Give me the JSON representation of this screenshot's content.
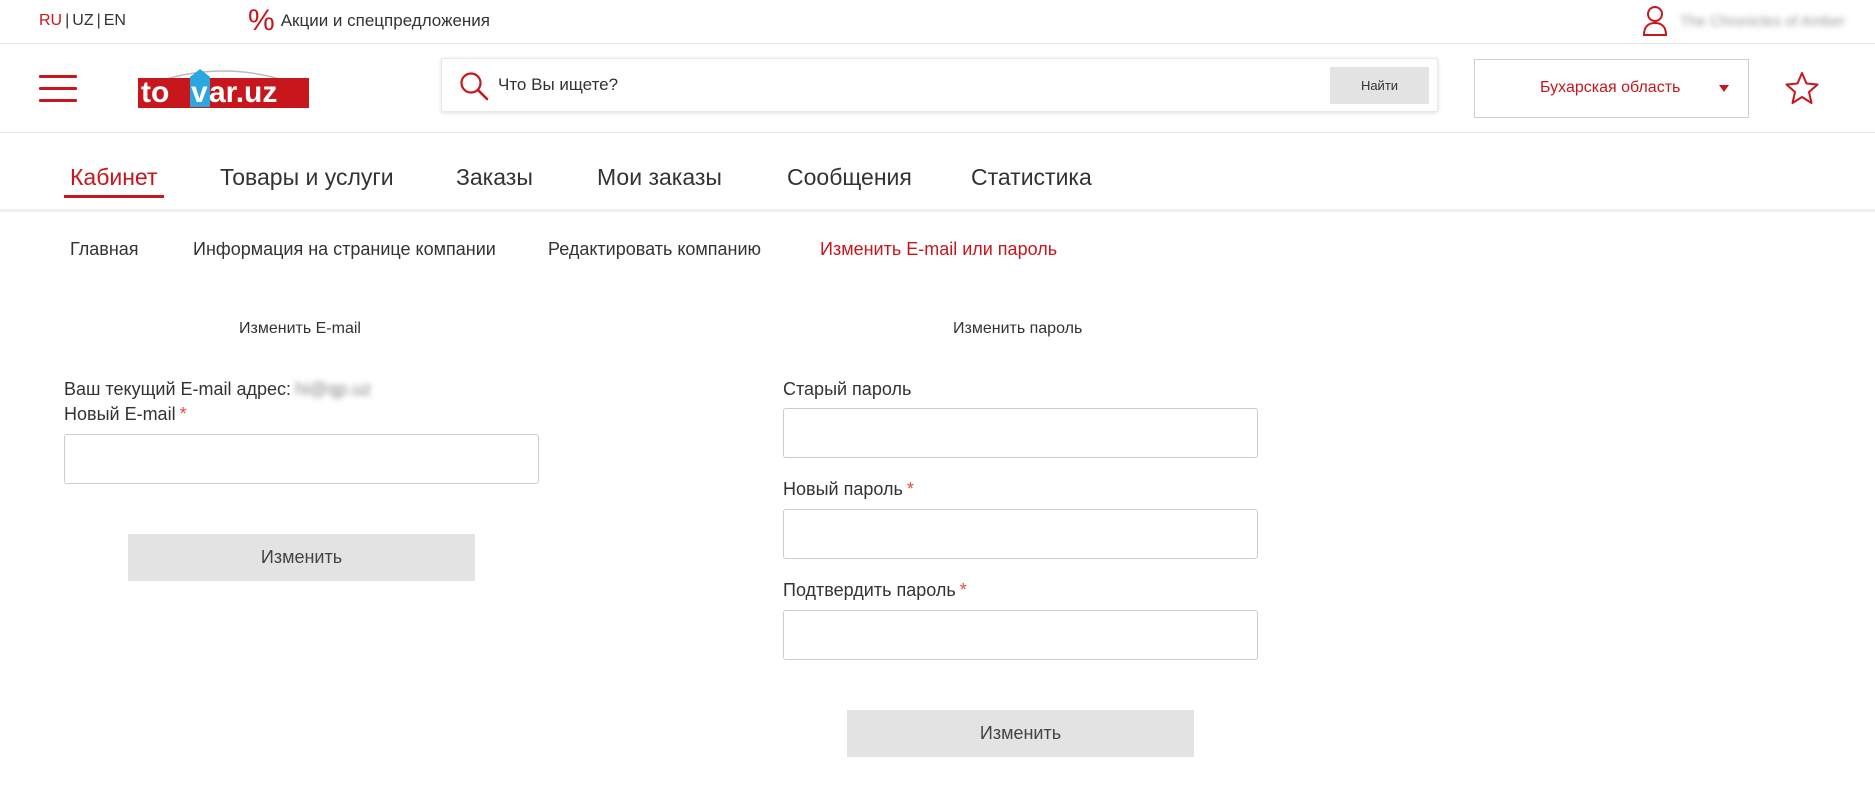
{
  "topbar": {
    "langs": [
      "RU",
      "UZ",
      "EN"
    ],
    "active_lang": "RU",
    "promo_symbol": "%",
    "promo_text": "Акции и спецпредложения",
    "user_name": "The Chronicles of Amber"
  },
  "header": {
    "logo_text": "tovar.uz",
    "search_placeholder": "Что Вы ищете?",
    "search_button": "Найти",
    "region": "Бухарская область"
  },
  "tabs": [
    {
      "label": "Кабинет",
      "active": true
    },
    {
      "label": "Товары и услуги"
    },
    {
      "label": "Заказы"
    },
    {
      "label": "Мои заказы"
    },
    {
      "label": "Сообщения"
    },
    {
      "label": "Статистика"
    }
  ],
  "subnav": [
    {
      "label": "Главная"
    },
    {
      "label": "Информация на странице компании"
    },
    {
      "label": "Редактировать компанию"
    },
    {
      "label": "Изменить E-mail или пароль",
      "active": true
    }
  ],
  "email_form": {
    "title": "Изменить E-mail",
    "current_label": "Ваш текущий E-mail адрес:",
    "current_value": "hi@qp.uz",
    "new_label": "Новый E-mail",
    "required_mark": "*",
    "submit": "Изменить"
  },
  "password_form": {
    "title": "Изменить пароль",
    "old_label": "Старый пароль",
    "new_label": "Новый пароль",
    "confirm_label": "Подтвердить пароль",
    "required_mark": "*",
    "submit": "Изменить"
  },
  "colors": {
    "accent": "#c8161d",
    "logo_blue": "#2aa6e0",
    "button_gray": "#e3e3e3"
  }
}
